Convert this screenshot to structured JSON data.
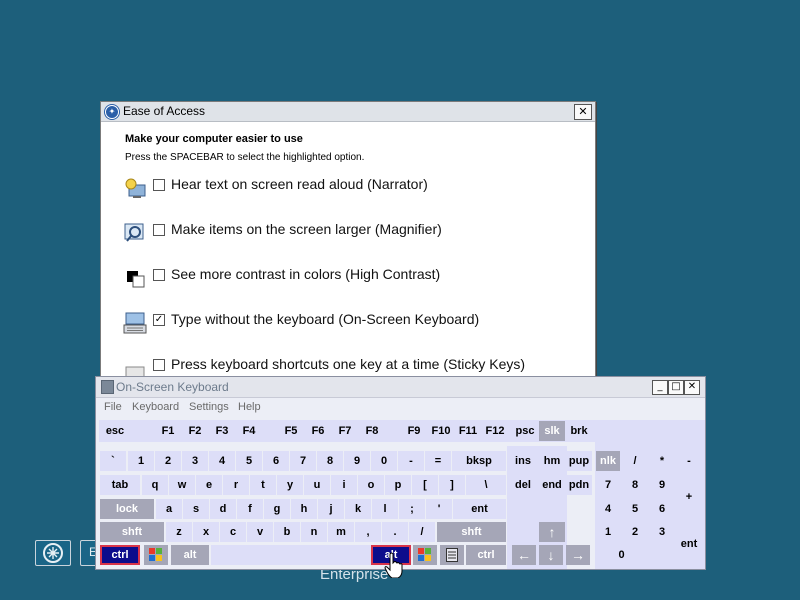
{
  "ease_dialog": {
    "title": "Ease of Access",
    "close_glyph": "✕",
    "heading": "Make your computer easier to use",
    "subheading": "Press the SPACEBAR to select the highlighted option.",
    "options": [
      {
        "label": "Hear text on screen read aloud (Narrator)",
        "checked": false,
        "icon": "narrator-icon"
      },
      {
        "label": "Make items on the screen larger (Magnifier)",
        "checked": false,
        "icon": "magnifier-icon"
      },
      {
        "label": "See more contrast in colors (High Contrast)",
        "checked": false,
        "icon": "high-contrast-icon"
      },
      {
        "label": "Type without the keyboard (On-Screen Keyboard)",
        "checked": true,
        "icon": "keyboard-icon"
      },
      {
        "label": "Press keyboard shortcuts one key at a time (Sticky Keys)",
        "checked": false,
        "icon": "sticky-keys-icon"
      }
    ]
  },
  "osk": {
    "title": "On-Screen Keyboard",
    "menu": [
      "File",
      "Keyboard",
      "Settings",
      "Help"
    ],
    "buttons": {
      "minimize": "_",
      "maximize": "□",
      "close": "✕"
    },
    "keys": {
      "esc": "esc",
      "f1": "F1",
      "f2": "F2",
      "f3": "F3",
      "f4": "F4",
      "f5": "F5",
      "f6": "F6",
      "f7": "F7",
      "f8": "F8",
      "f9": "F9",
      "f10": "F10",
      "f11": "F11",
      "f12": "F12",
      "psc": "psc",
      "slk": "slk",
      "brk": "brk",
      "grave": "`",
      "n1": "1",
      "n2": "2",
      "n3": "3",
      "n4": "4",
      "n5": "5",
      "n6": "6",
      "n7": "7",
      "n8": "8",
      "n9": "9",
      "n0": "0",
      "minus": "-",
      "equals": "=",
      "bksp": "bksp",
      "ins": "ins",
      "hm": "hm",
      "pup": "pup",
      "nlk": "nlk",
      "kp_div": "/",
      "kp_mul": "*",
      "kp_sub": "-",
      "tab": "tab",
      "q": "q",
      "w": "w",
      "e": "e",
      "r": "r",
      "t": "t",
      "y": "y",
      "u": "u",
      "i": "i",
      "o": "o",
      "p": "p",
      "lbr": "[",
      "rbr": "]",
      "bslash": "\\",
      "del": "del",
      "end": "end",
      "pdn": "pdn",
      "kp7": "7",
      "kp8": "8",
      "kp9": "9",
      "kp_add": "+",
      "lock": "lock",
      "a": "a",
      "s": "s",
      "d": "d",
      "f": "f",
      "g": "g",
      "h": "h",
      "j": "j",
      "k": "k",
      "l": "l",
      "semi": ";",
      "quote": "'",
      "ent": "ent",
      "kp4": "4",
      "kp5": "5",
      "kp6": "6",
      "lshft": "shft",
      "z": "z",
      "x": "x",
      "c": "c",
      "v": "v",
      "b": "b",
      "n": "n",
      "m": "m",
      "comma": ",",
      "period": ".",
      "slash": "/",
      "rshft": "shft",
      "up": "↑",
      "kp1": "1",
      "kp2": "2",
      "kp3": "3",
      "lctrl": "ctrl",
      "lalt": "alt",
      "ralt": "alt",
      "rctrl": "ctrl",
      "left": "←",
      "down": "↓",
      "right": "→",
      "kp0": "0",
      "kp_ent": "ent"
    }
  },
  "taskbar": {
    "partial_label": "E",
    "watermark": "Enterprise"
  },
  "colors": {
    "desktop": "#1d5f7b",
    "key_face": "#dddef8",
    "key_selected": "#0c0c8c",
    "key_selected_border": "#d8344a"
  }
}
